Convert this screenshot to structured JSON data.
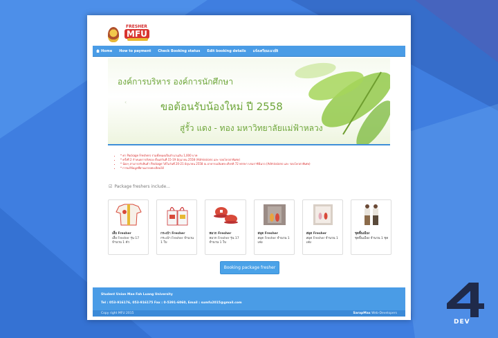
{
  "header": {
    "fresher_logo_top": "FRESHER",
    "fresher_logo_main": "MFU"
  },
  "nav": {
    "items": [
      {
        "label": "Home",
        "icon": "home-icon"
      },
      {
        "label": "How to payment"
      },
      {
        "label": "Check Booking status"
      },
      {
        "label": "Edit booking details"
      },
      {
        "label": "แจ้งเตรียมเนวย์ลิ"
      }
    ]
  },
  "banner": {
    "line1": "องค์การบริหาร  องค์การนักศึกษา",
    "line2": "ขอต้อนรับน้องใหม่ ปี 2558",
    "line3": "สู่รั้ว แดง - ทอง มหาวิทยาลัยแม่ฟ้าหลวง"
  },
  "notes": [
    "* ค่า Package Freshers ร่วมทั้งหมดเป็นจำนวนเงิน 1,000 บาท",
    "* ครั้งที่ 2 กำหนดการสั่งของ ตั้งแต่วันที่ 15-19 มิถุนายน 2558 (Admissions และ รอบโควตาพิเศษ)",
    "* น้องๆ สามารถรับสินค้า Package ได้ในวันที่ 20-21 มิถุนายน 2558 ณ อาคารเฉลิมพระเกียรติ 72 พรรษา บรมราชินีนาถ (Admissions และ รอบโควตาพิเศษ)",
    "* การแก้ข้อมูลที่ผ่านมาลงทะเบียนได้"
  ],
  "section_title": "Package freshers include...",
  "cards": [
    {
      "name": "เสื้อ Fresher",
      "desc": "เสื้อ Fresher รุ่น 17 จำนวน 1 ตัว"
    },
    {
      "name": "กระเป๋า Fresher",
      "desc": "กระเป๋า Fresher จำนวน 1 ใบ"
    },
    {
      "name": "หมวก Fresher",
      "desc": "หมวก Fresher รุ่น 17 จำนวน 1 ใบ"
    },
    {
      "name": "สมุด Fresher",
      "desc": "สมุด Fresher จำนวน 1 เล่ม"
    },
    {
      "name": "สมุด Fresher",
      "desc": "สมุด Fresher จำนวน 1 เล่ม"
    },
    {
      "name": "ชุดพื้นเมือง",
      "desc": "ชุดพื้นเมือง จำนวน 1 ชุด"
    }
  ],
  "booking_button": "Booking package fresher",
  "footer": {
    "org": "Student Union Mae Fah Luang University",
    "contact": "Tel : 053-916176, 053-916175 Fax : 0-5391-6060, Email : sumfu2015@gmail.com",
    "copyright": "Copy right MFU 2015",
    "developer_bold": "SarapMax",
    "developer_rest": " Web-Developers"
  },
  "watermark": {
    "number": "4",
    "word": "DEV"
  },
  "colors": {
    "background": "#3f7ee0",
    "nav": "#4a9ce6",
    "banner_text": "#6ea63a",
    "notes_text": "#d92c2c"
  }
}
